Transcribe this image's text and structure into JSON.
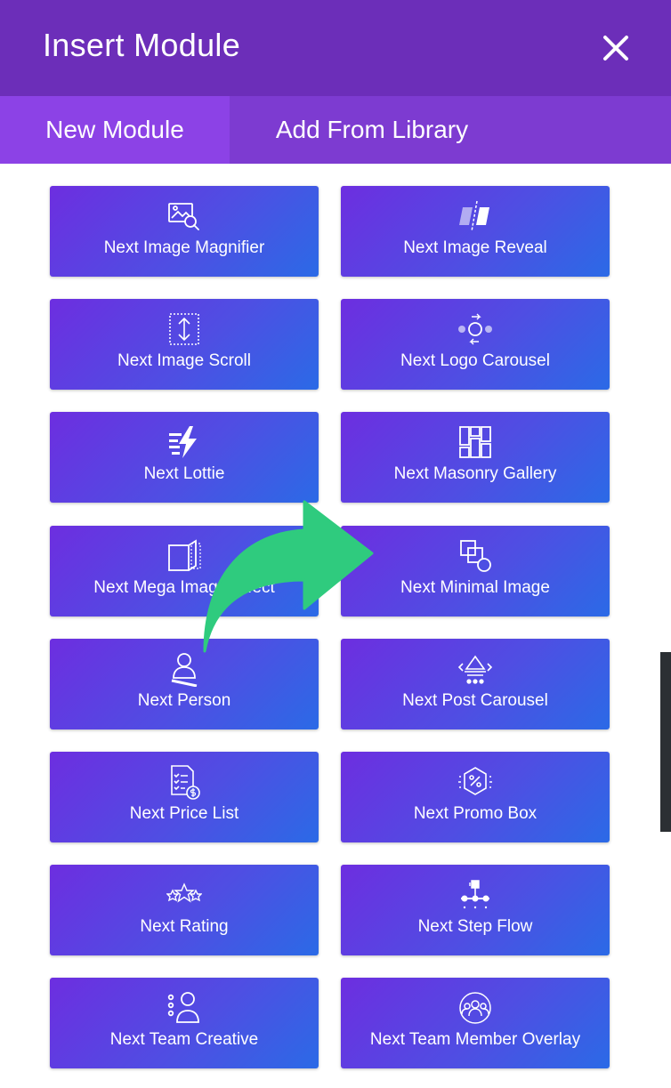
{
  "header": {
    "title": "Insert Module"
  },
  "tabs": [
    {
      "label": "New Module"
    },
    {
      "label": "Add From Library"
    }
  ],
  "modules": [
    {
      "label": "Next Image Magnifier",
      "icon": "image-magnifier-icon"
    },
    {
      "label": "Next Image Reveal",
      "icon": "image-reveal-icon"
    },
    {
      "label": "Next Image Scroll",
      "icon": "image-scroll-icon"
    },
    {
      "label": "Next Logo Carousel",
      "icon": "logo-carousel-icon"
    },
    {
      "label": "Next Lottie",
      "icon": "lottie-icon"
    },
    {
      "label": "Next Masonry Gallery",
      "icon": "masonry-gallery-icon"
    },
    {
      "label": "Next Mega Image Effect",
      "icon": "mega-image-effect-icon"
    },
    {
      "label": "Next Minimal Image",
      "icon": "minimal-image-icon"
    },
    {
      "label": "Next Person",
      "icon": "person-icon"
    },
    {
      "label": "Next Post Carousel",
      "icon": "post-carousel-icon"
    },
    {
      "label": "Next Price List",
      "icon": "price-list-icon"
    },
    {
      "label": "Next Promo Box",
      "icon": "promo-box-icon"
    },
    {
      "label": "Next Rating",
      "icon": "rating-icon"
    },
    {
      "label": "Next Step Flow",
      "icon": "step-flow-icon"
    },
    {
      "label": "Next Team Creative",
      "icon": "team-creative-icon"
    },
    {
      "label": "Next Team Member Overlay",
      "icon": "team-member-overlay-icon"
    }
  ],
  "colors": {
    "header": "#6c2eb9",
    "tab_active": "#8c42e6",
    "card_start": "#6d2ee0",
    "card_end": "#2b6ae6",
    "arrow": "#2fcb7e"
  }
}
